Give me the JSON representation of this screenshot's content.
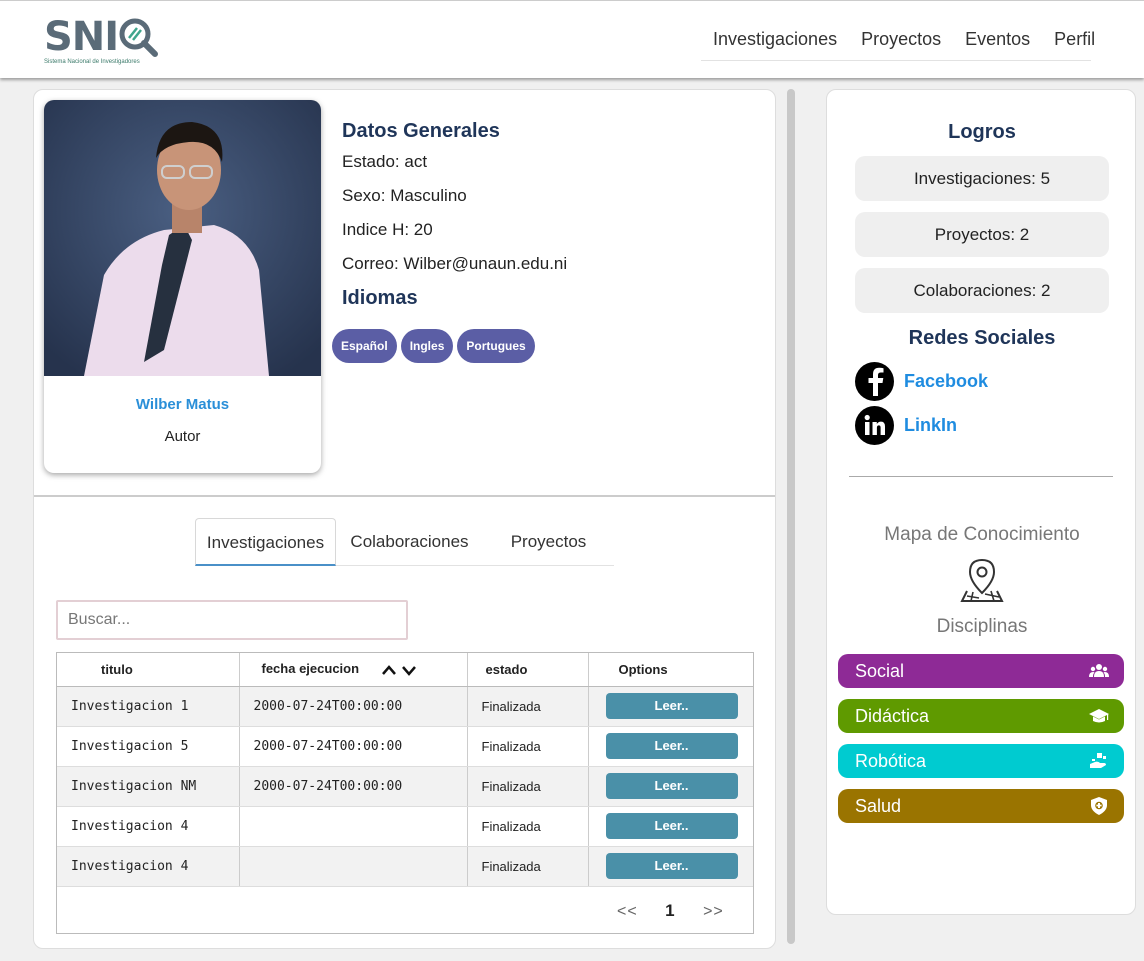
{
  "header": {
    "logo_text": "SNI",
    "logo_subtitle": "Sistema Nacional de Investigadores",
    "nav": [
      "Investigaciones",
      "Proyectos",
      "Eventos",
      "Perfil"
    ]
  },
  "profile": {
    "name": "Wilber Matus",
    "role": "Autor",
    "general_title": "Datos Generales",
    "estado": "Estado: act",
    "sexo": "Sexo: Masculino",
    "indice": "Indice H: 20",
    "correo": "Correo: Wilber@unaun.edu.ni",
    "languages_title": "Idiomas",
    "languages": [
      "Español",
      "Ingles",
      "Portugues"
    ]
  },
  "tabs": [
    "Investigaciones",
    "Colaboraciones",
    "Proyectos"
  ],
  "search": {
    "placeholder": "Buscar..."
  },
  "table": {
    "headers": [
      "titulo",
      "fecha ejecucion",
      "estado",
      "Options"
    ],
    "rows": [
      {
        "titulo": "Investigacion 1",
        "fecha": "2000-07-24T00:00:00",
        "estado": "Finalizada",
        "action": "Leer.."
      },
      {
        "titulo": "Investigacion 5",
        "fecha": "2000-07-24T00:00:00",
        "estado": "Finalizada",
        "action": "Leer.."
      },
      {
        "titulo": "Investigacion NM",
        "fecha": "2000-07-24T00:00:00",
        "estado": "Finalizada",
        "action": "Leer.."
      },
      {
        "titulo": "Investigacion 4",
        "fecha": "",
        "estado": "Finalizada",
        "action": "Leer.."
      },
      {
        "titulo": "Investigacion 4",
        "fecha": "",
        "estado": "Finalizada",
        "action": "Leer.."
      }
    ]
  },
  "pagination": {
    "prev": "<<",
    "page": "1",
    "next": ">>"
  },
  "sidebar": {
    "logros_title": "Logros",
    "stats": [
      "Investigaciones: 5",
      "Proyectos: 2",
      "Colaboraciones: 2"
    ],
    "redes_title": "Redes Sociales",
    "socials": [
      {
        "label": "Facebook",
        "icon": "facebook-icon"
      },
      {
        "label": "LinkIn",
        "icon": "linkedin-icon"
      }
    ],
    "mapa_title": "Mapa de Conocimiento",
    "disciplinas_title": "Disciplinas",
    "disciplines": [
      {
        "label": "Social",
        "color": "#8e2a96",
        "icon": "people-icon"
      },
      {
        "label": "Didáctica",
        "color": "#5f9a00",
        "icon": "graduation-cap-icon"
      },
      {
        "label": "Robótica",
        "color": "#00cbd0",
        "icon": "robot-hand-icon"
      },
      {
        "label": "Salud",
        "color": "#9a7400",
        "icon": "health-shield-icon"
      }
    ]
  }
}
